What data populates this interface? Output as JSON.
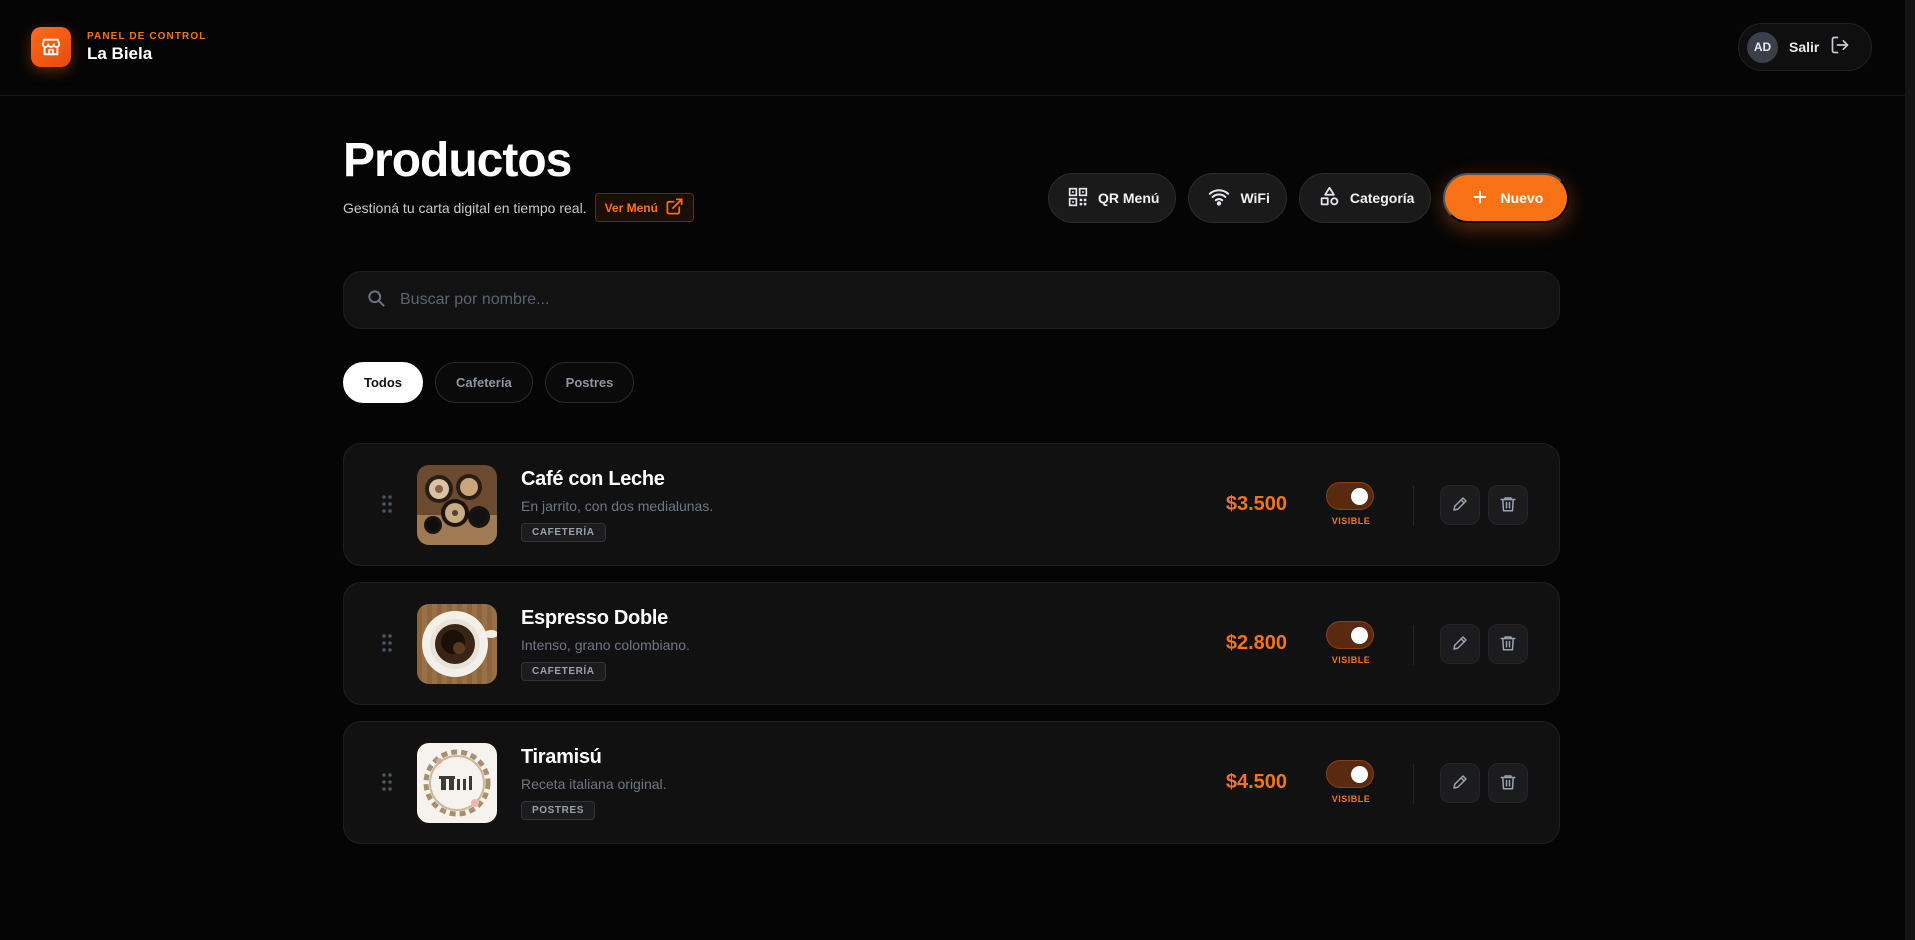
{
  "header": {
    "eyebrow": "PANEL DE CONTROL",
    "business_name": "La Biela",
    "user_initials": "AD",
    "logout_label": "Salir"
  },
  "page": {
    "title": "Productos",
    "subtitle": "Gestioná tu carta digital en tiempo real.",
    "view_menu_label": "Ver Menú"
  },
  "actions": {
    "qr_label": "QR Menú",
    "wifi_label": "WiFi",
    "category_label": "Categoría",
    "new_label": "Nuevo"
  },
  "search": {
    "placeholder": "Buscar por nombre...",
    "value": ""
  },
  "filters": [
    {
      "label": "Todos",
      "active": true
    },
    {
      "label": "Cafetería",
      "active": false
    },
    {
      "label": "Postres",
      "active": false
    }
  ],
  "products": [
    {
      "name": "Café con Leche",
      "description": "En jarrito, con dos medialunas.",
      "category": "CAFETERÍA",
      "price": "$3.500",
      "visible": true,
      "visible_label": "VISIBLE",
      "image": "coffee-cups-photo"
    },
    {
      "name": "Espresso Doble",
      "description": "Intenso, grano colombiano.",
      "category": "CAFETERÍA",
      "price": "$2.800",
      "visible": true,
      "visible_label": "VISIBLE",
      "image": "espresso-cup-photo"
    },
    {
      "name": "Tiramisú",
      "description": "Receta italiana original.",
      "category": "POSTRES",
      "price": "$4.500",
      "visible": true,
      "visible_label": "VISIBLE",
      "image": "tiramisu-illustration"
    }
  ],
  "colors": {
    "accent": "#f97316",
    "background": "#050505",
    "card": "#111111"
  },
  "icons": [
    "store-icon",
    "logout-icon",
    "external-link-icon",
    "qr-code-icon",
    "wifi-icon",
    "shapes-icon",
    "plus-icon",
    "search-icon",
    "drag-handle-icon",
    "pencil-icon",
    "trash-icon"
  ]
}
